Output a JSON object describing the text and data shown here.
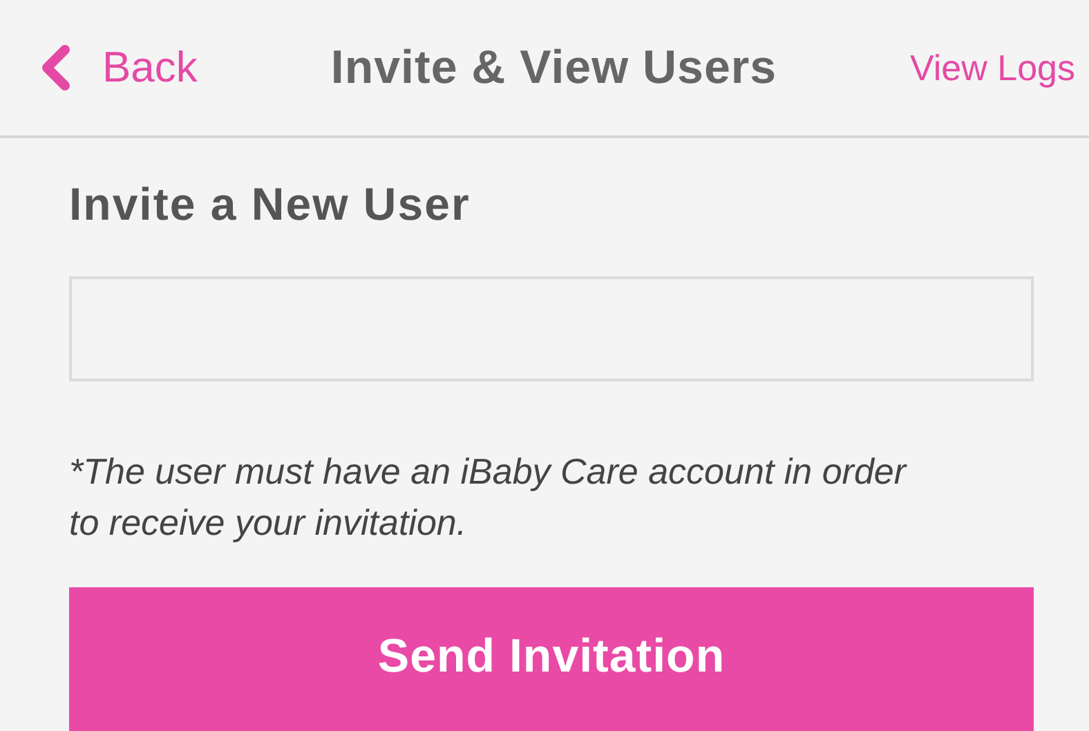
{
  "nav_bar": {
    "back": "Back",
    "title": "Invite & View Users",
    "action": "View Logs"
  },
  "section_title": "Invite a New User",
  "note": "*The user must have an iBaby Care account in order to receive your invitation.",
  "send_button": "Send Invitation"
}
